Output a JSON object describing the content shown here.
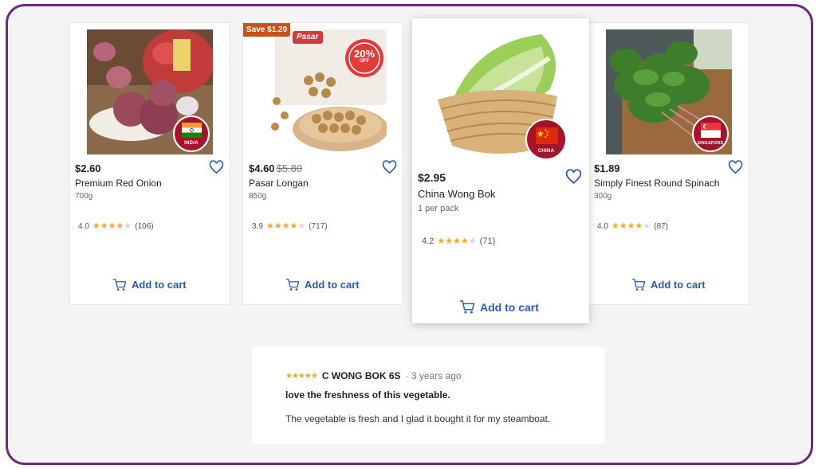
{
  "products": [
    {
      "price": "$2.60",
      "old_price": "",
      "name": "Premium Red Onion",
      "size": "700g",
      "rating": "4.0",
      "stars": 4,
      "reviews": "(106)",
      "origin": "INDIA",
      "cart_label": "Add to cart",
      "save_tag": ""
    },
    {
      "price": "$4.60",
      "old_price": "$5.80",
      "name": "Pasar Longan",
      "size": "850g",
      "rating": "3.9",
      "stars": 4,
      "reviews": "(717)",
      "origin": "",
      "cart_label": "Add to cart",
      "save_tag": "Save $1.20",
      "package_brand": "Pasar",
      "package_discount": "20%",
      "package_discount_sub": "OFF"
    },
    {
      "price": "$2.95",
      "old_price": "",
      "name": "China Wong Bok",
      "size": "1 per pack",
      "rating": "4.2",
      "stars": 4,
      "reviews": "(71)",
      "origin": "CHINA",
      "cart_label": "Add to cart",
      "save_tag": ""
    },
    {
      "price": "$1.89",
      "old_price": "",
      "name": "Simply Finest Round Spinach",
      "size": "300g",
      "rating": "4.0",
      "stars": 4,
      "reviews": "(87)",
      "origin": "SINGAPORE",
      "cart_label": "Add to cart",
      "save_tag": ""
    }
  ],
  "review": {
    "stars": 5,
    "author": "C WONG BOK 6S",
    "separator": "·",
    "time": "3 years ago",
    "title": "love the freshness of this vegetable.",
    "body": "The vegetable is fresh and I glad it bought it for my steamboat."
  },
  "colors": {
    "frame_border": "#6e2a7e",
    "accent_blue": "#2a5ca8",
    "star": "#f5a623",
    "save_tag": "#c8511c",
    "badge": "#a3152a"
  }
}
